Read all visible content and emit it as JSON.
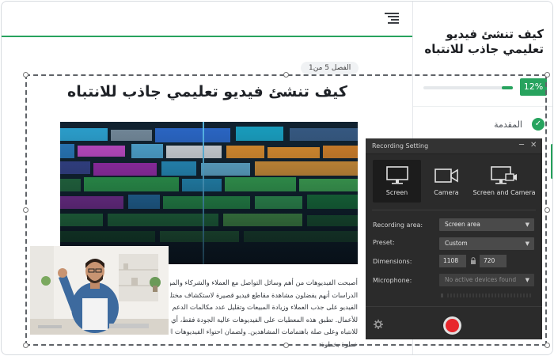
{
  "sidebar": {
    "course_title": "كيف تنشئ فيديو تعليمي جاذب للانتباه",
    "progress_percent": "12%",
    "progress_value": 0.12,
    "lesson_label": "المقدمة",
    "accent_color": "#27a35e"
  },
  "lesson": {
    "chapter_label": "الفصل 5 من1",
    "heading": "كيف تنشئ فيديو تعليمي جاذب للانتباه",
    "body_lines": [
      "أصبحت الفيديوهات من أهم وسائل التواصل مع العملاء والشركاء والموظ",
      "الدراسات أنهم يفضلون مشاهدة مقاطع فيديو قصيرة لاستكشاف مختلف",
      "الفيديو على جذب العملاء وزيادة المبيعات وتقليل عدد مكالمات الدعم التا",
      "للأعمال. تطبق هذه المعطيات على الفيديوهات عالية الجودة فقط، أي أن",
      "للانتباه وعلى صلة باهتمامات المشاهدين. ولضمان احتواء الفيديوهات الت",
      "خطوة بخطوة:"
    ]
  },
  "recorder": {
    "title": "Recording Setting",
    "modes": [
      {
        "label": "Screen",
        "icon": "monitor-icon",
        "active": true
      },
      {
        "label": "Camera",
        "icon": "camera-icon",
        "active": false
      },
      {
        "label": "Screen and Camera",
        "icon": "screen-camera-icon",
        "active": false
      }
    ],
    "recording_area_label": "Recording area:",
    "recording_area_value": "Screen area",
    "preset_label": "Preset:",
    "preset_value": "Custom",
    "dimensions_label": "Dimensions:",
    "width": "1108",
    "height": "720",
    "microphone_label": "Microphone:",
    "microphone_value": "No active devices found",
    "record_color": "#e8262b"
  }
}
